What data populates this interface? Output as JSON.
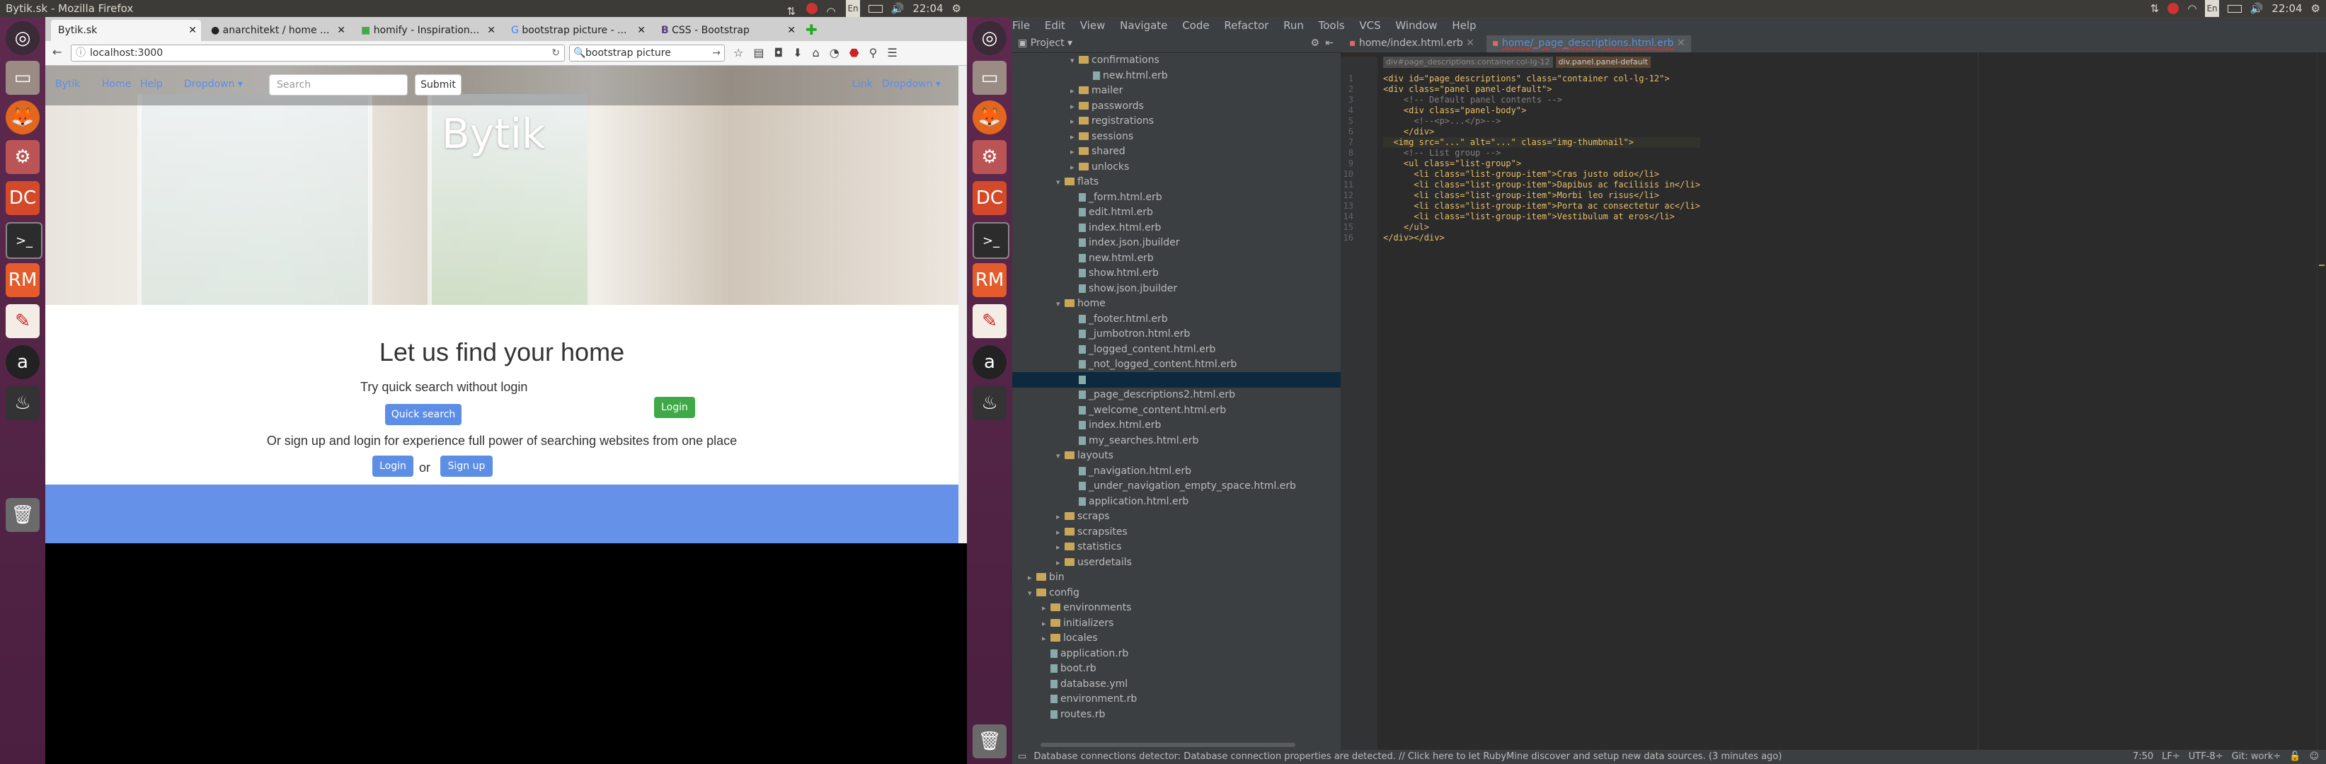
{
  "left_screen": {
    "window_title": "Bytik.sk - Mozilla Firefox",
    "clock": "22:04"
  },
  "right_screen": {
    "clock": "22:04"
  },
  "firefox": {
    "tabs": [
      {
        "label": "Bytik.sk"
      },
      {
        "label": "anarchitekt / home ..."
      },
      {
        "label": "homify - Inspiration..."
      },
      {
        "label": "bootstrap picture - ..."
      },
      {
        "label": "CSS - Bootstrap"
      }
    ],
    "url": "localhost:3000",
    "search_value": "bootstrap picture"
  },
  "site": {
    "search_placeholder": "Search",
    "submit_label": "Submit",
    "brand": "Bytik",
    "headline": "Let us find your home",
    "quick_text": "Try quick search without login",
    "quick_search_label": "Quick search",
    "login_right_label": "Login",
    "signup_text": "Or sign up and login for experience full power of searching websites from one place",
    "login_label": "Login",
    "or_text": "or",
    "signup_label": "Sign up"
  },
  "rubymine": {
    "menu": [
      "File",
      "Edit",
      "View",
      "Navigate",
      "Code",
      "Refactor",
      "Run",
      "Tools",
      "VCS",
      "Window",
      "Help"
    ],
    "project_label": "Project",
    "editor_tabs": [
      {
        "label": "home/index.html.erb"
      },
      {
        "label": "home/_page_descriptions.html.erb"
      }
    ],
    "breadcrumb": [
      "div#page_descriptions.container.col-lg-12",
      "div.panel.panel-default"
    ],
    "tree": [
      {
        "label": "confirmations",
        "kind": "folder",
        "depth": 3,
        "open": true
      },
      {
        "label": "new.html.erb",
        "kind": "file",
        "depth": 4
      },
      {
        "label": "mailer",
        "kind": "folder",
        "depth": 3
      },
      {
        "label": "passwords",
        "kind": "folder",
        "depth": 3
      },
      {
        "label": "registrations",
        "kind": "folder",
        "depth": 3
      },
      {
        "label": "sessions",
        "kind": "folder",
        "depth": 3
      },
      {
        "label": "shared",
        "kind": "folder",
        "depth": 3
      },
      {
        "label": "unlocks",
        "kind": "folder",
        "depth": 3
      },
      {
        "label": "flats",
        "kind": "folder",
        "depth": 2,
        "open": true
      },
      {
        "label": "_form.html.erb",
        "kind": "file",
        "depth": 3
      },
      {
        "label": "edit.html.erb",
        "kind": "file",
        "depth": 3
      },
      {
        "label": "index.html.erb",
        "kind": "file",
        "depth": 3
      },
      {
        "label": "index.json.jbuilder",
        "kind": "file",
        "depth": 3
      },
      {
        "label": "new.html.erb",
        "kind": "file",
        "depth": 3
      },
      {
        "label": "show.html.erb",
        "kind": "file",
        "depth": 3
      },
      {
        "label": "show.json.jbuilder",
        "kind": "file",
        "depth": 3
      },
      {
        "label": "home",
        "kind": "folder",
        "depth": 2,
        "open": true
      },
      {
        "label": "_footer.html.erb",
        "kind": "file",
        "depth": 3
      },
      {
        "label": "_jumbotron.html.erb",
        "kind": "file",
        "depth": 3
      },
      {
        "label": "_logged_content.html.erb",
        "kind": "file",
        "depth": 3
      },
      {
        "label": "_not_logged_content.html.erb",
        "kind": "file",
        "depth": 3
      },
      {
        "label": "",
        "kind": "file",
        "depth": 3,
        "selected": true
      },
      {
        "label": "_page_descriptions2.html.erb",
        "kind": "file",
        "depth": 3
      },
      {
        "label": "_welcome_content.html.erb",
        "kind": "file",
        "depth": 3
      },
      {
        "label": "index.html.erb",
        "kind": "file",
        "depth": 3
      },
      {
        "label": "my_searches.html.erb",
        "kind": "file",
        "depth": 3
      },
      {
        "label": "layouts",
        "kind": "folder",
        "depth": 2,
        "open": true
      },
      {
        "label": "_navigation.html.erb",
        "kind": "file",
        "depth": 3
      },
      {
        "label": "_under_navigation_empty_space.html.erb",
        "kind": "file",
        "depth": 3
      },
      {
        "label": "application.html.erb",
        "kind": "file",
        "depth": 3
      },
      {
        "label": "scraps",
        "kind": "folder",
        "depth": 2
      },
      {
        "label": "scrapsites",
        "kind": "folder",
        "depth": 2
      },
      {
        "label": "statistics",
        "kind": "folder",
        "depth": 2
      },
      {
        "label": "userdetails",
        "kind": "folder",
        "depth": 2
      },
      {
        "label": "bin",
        "kind": "folder",
        "depth": 0
      },
      {
        "label": "config",
        "kind": "folder",
        "depth": 0,
        "open": true
      },
      {
        "label": "environments",
        "kind": "folder",
        "depth": 1
      },
      {
        "label": "initializers",
        "kind": "folder",
        "depth": 1
      },
      {
        "label": "locales",
        "kind": "folder",
        "depth": 1
      },
      {
        "label": "application.rb",
        "kind": "file",
        "depth": 1
      },
      {
        "label": "boot.rb",
        "kind": "file",
        "depth": 1
      },
      {
        "label": "database.yml",
        "kind": "file",
        "depth": 1
      },
      {
        "label": "environment.rb",
        "kind": "file",
        "depth": 1
      },
      {
        "label": "routes.rb",
        "kind": "file",
        "depth": 1
      }
    ],
    "code_lines": [
      "<div id=\"page_descriptions\" class=\"container col-lg-12\">",
      "<div class=\"panel panel-default\">",
      "    <!-- Default panel contents -->",
      "    <div class=\"panel-body\">",
      "      <!--<p>...</p>-->",
      "    </div>",
      "  <img src=\"...\" alt=\"...\" class=\"img-thumbnail\">",
      "    <!-- List group -->",
      "    <ul class=\"list-group\">",
      "      <li class=\"list-group-item\">Cras justo odio</li>",
      "      <li class=\"list-group-item\">Dapibus ac facilisis in</li>",
      "      <li class=\"list-group-item\">Morbi leo risus</li>",
      "      <li class=\"list-group-item\">Porta ac consectetur ac</li>",
      "      <li class=\"list-group-item\">Vestibulum at eros</li>",
      "    </ul>",
      "</div></div>"
    ],
    "status_message": "Database connections detector: Database connection properties are detected. // Click here to let RubyMine discover and setup new data sources. (3 minutes ago)",
    "cursor_pos": "7:50",
    "line_sep": "LF÷",
    "encoding": "UTF-8÷",
    "git_branch": "Git: work÷"
  }
}
